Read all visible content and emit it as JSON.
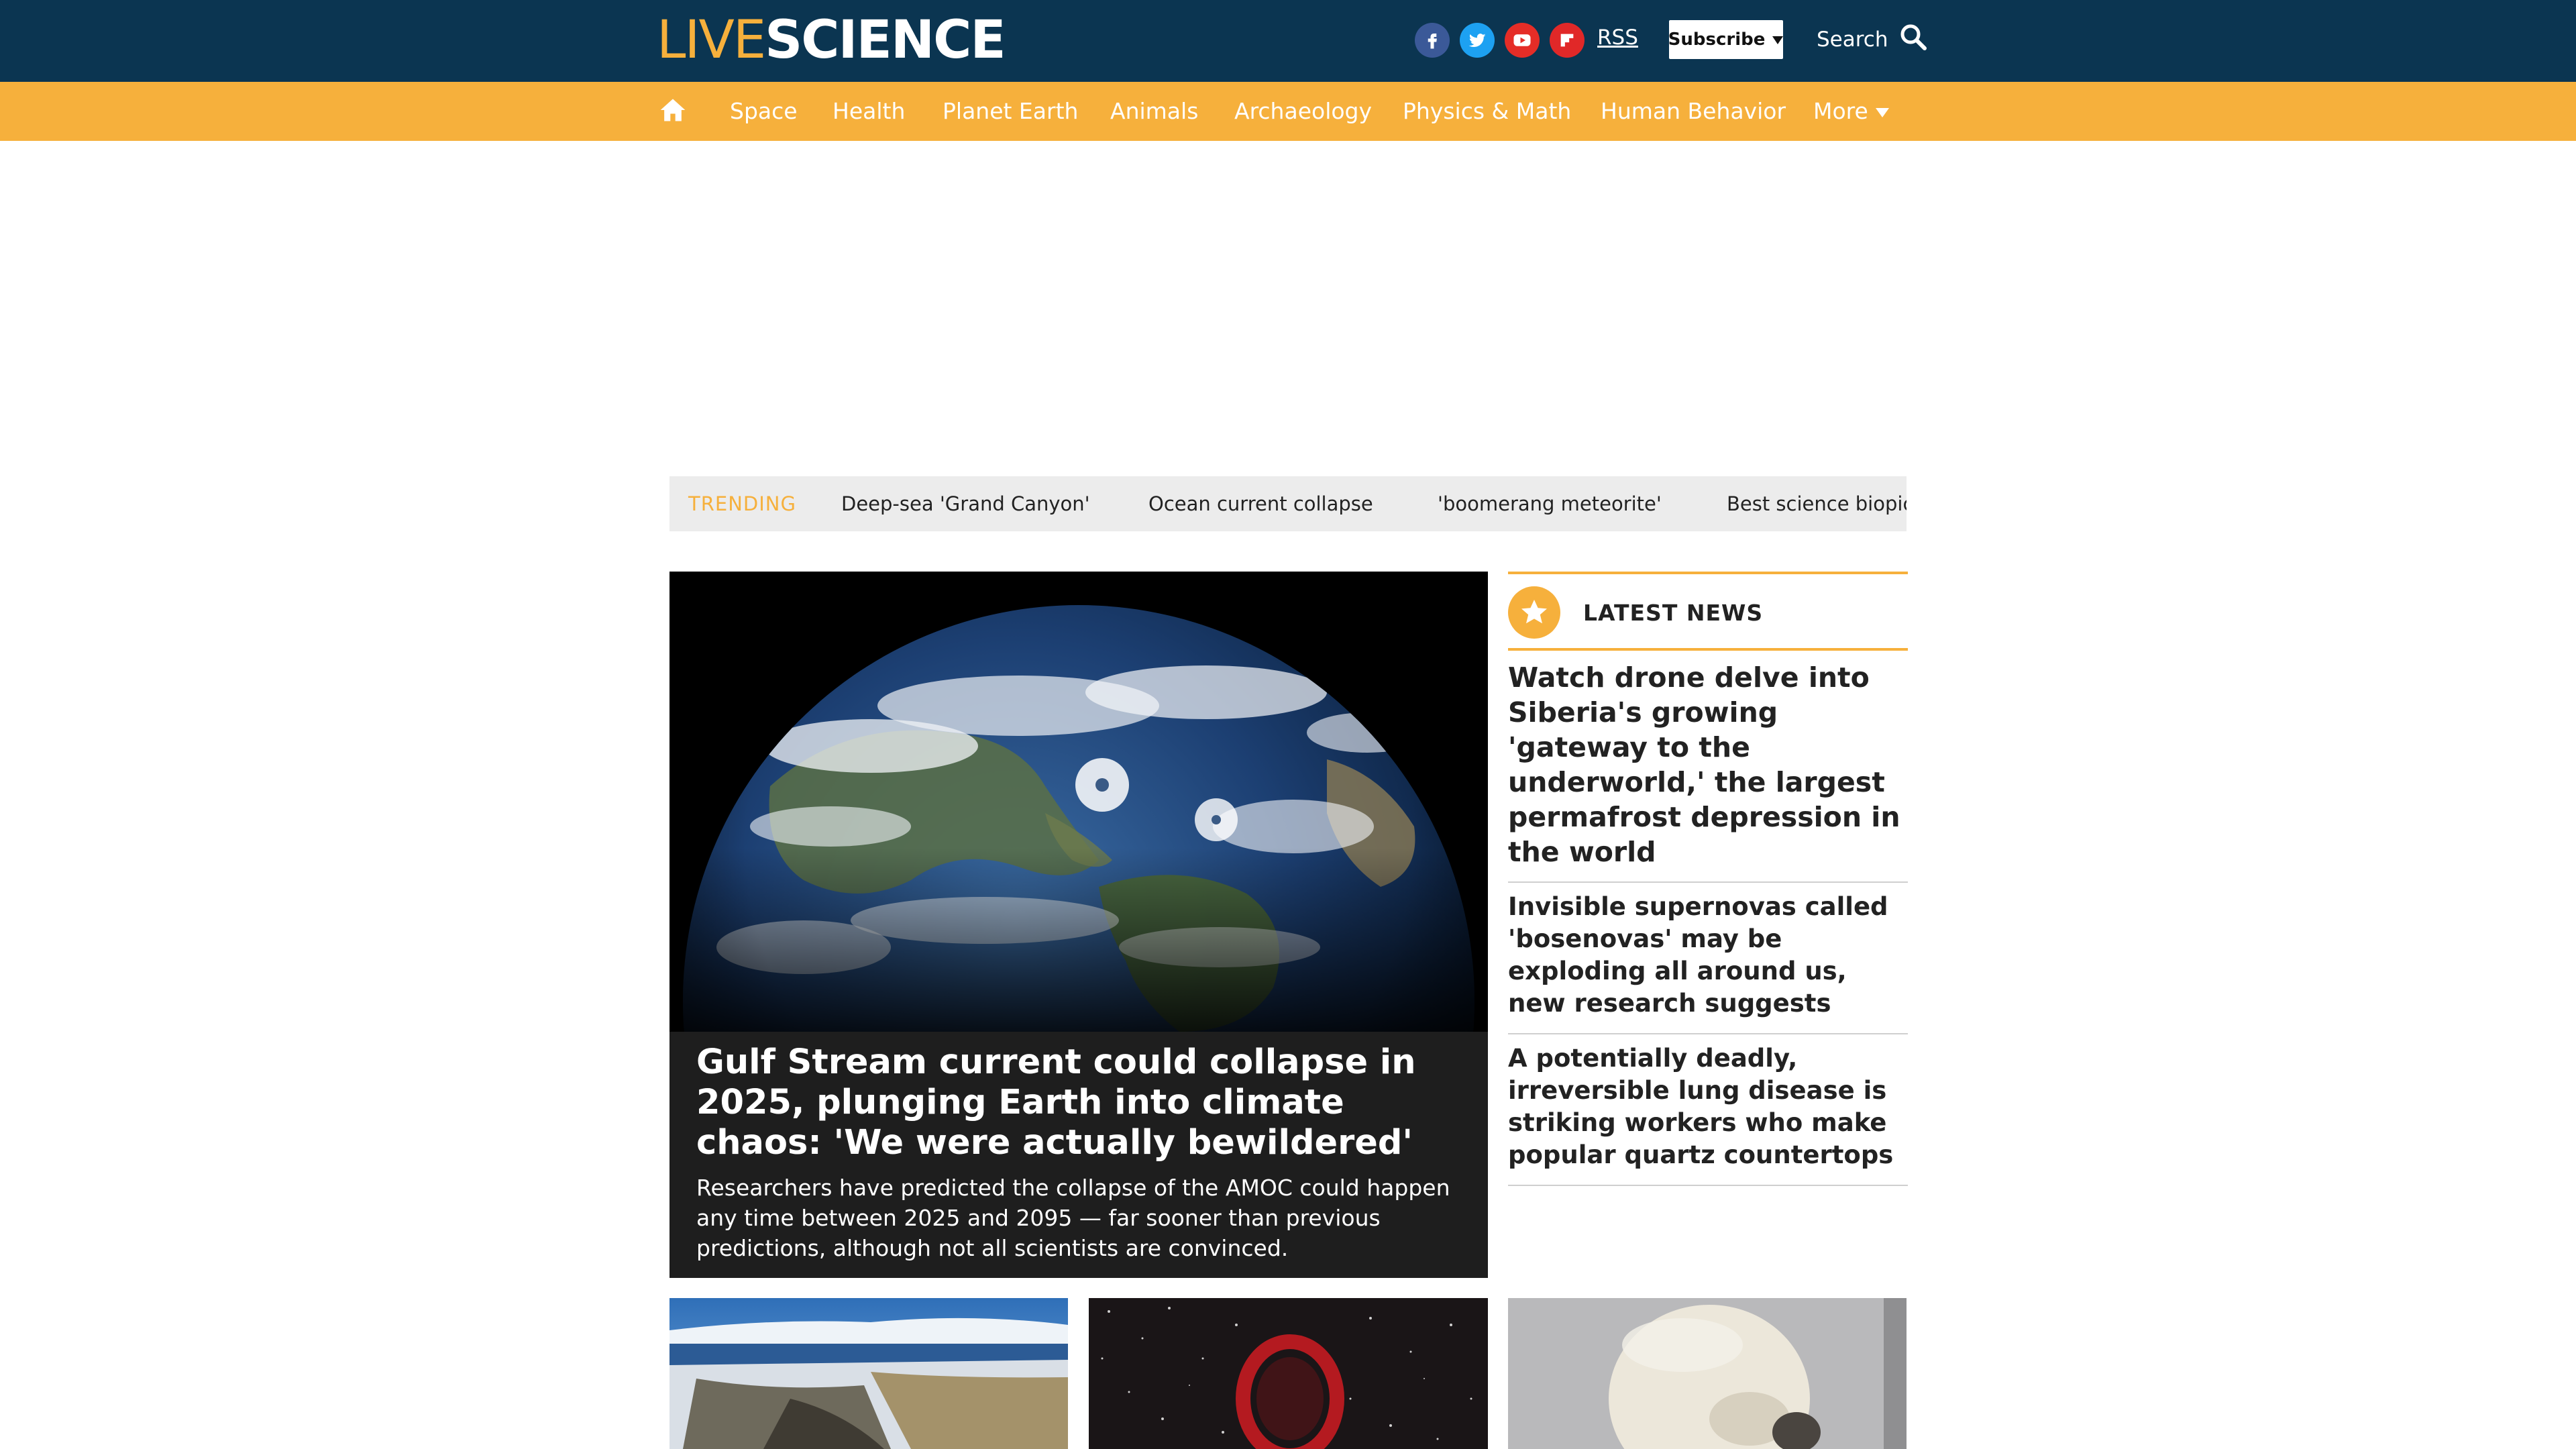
{
  "header": {
    "logo_live": "LIVE",
    "logo_science": "SCIENCE",
    "social": [
      {
        "name": "facebook",
        "icon": "facebook-icon",
        "color": "#3b5998"
      },
      {
        "name": "twitter",
        "icon": "twitter-icon",
        "color": "#1da1f2"
      },
      {
        "name": "youtube",
        "icon": "youtube-icon",
        "color": "#e52d27"
      },
      {
        "name": "flipboard",
        "icon": "flipboard-icon",
        "color": "#e12828"
      }
    ],
    "rss_label": "RSS",
    "subscribe_label": "Subscribe",
    "search_label": "Search",
    "colors": {
      "topbar": "#0b3551",
      "accent": "#f6b03c"
    }
  },
  "nav": {
    "home_icon": "home-icon",
    "items": [
      "Space",
      "Health",
      "Planet Earth",
      "Animals",
      "Archaeology",
      "Physics & Math",
      "Human Behavior"
    ],
    "more_label": "More"
  },
  "trending": {
    "label": "TRENDING",
    "items": [
      "Deep-sea 'Grand Canyon'",
      "Ocean current collapse",
      "'boomerang meteorite'",
      "Best science biopics"
    ]
  },
  "hero": {
    "title": "Gulf Stream current could collapse in 2025, plunging Earth into climate chaos: 'We were actually bewildered'",
    "description": "Researchers have predicted the collapse of the AMOC could happen any time between 2025 and 2095 — far sooner than previous predictions, although not all scientists are convinced."
  },
  "latest_news": {
    "label": "LATEST NEWS",
    "items": [
      "Watch drone delve into Siberia's growing 'gateway to the underworld,' the largest permafrost depression in the world",
      "Invisible supernovas called 'bosenovas' may be exploding all around us, new research suggests",
      "A potentially deadly, irreversible lung disease is striking workers who make popular quartz countertops"
    ]
  }
}
